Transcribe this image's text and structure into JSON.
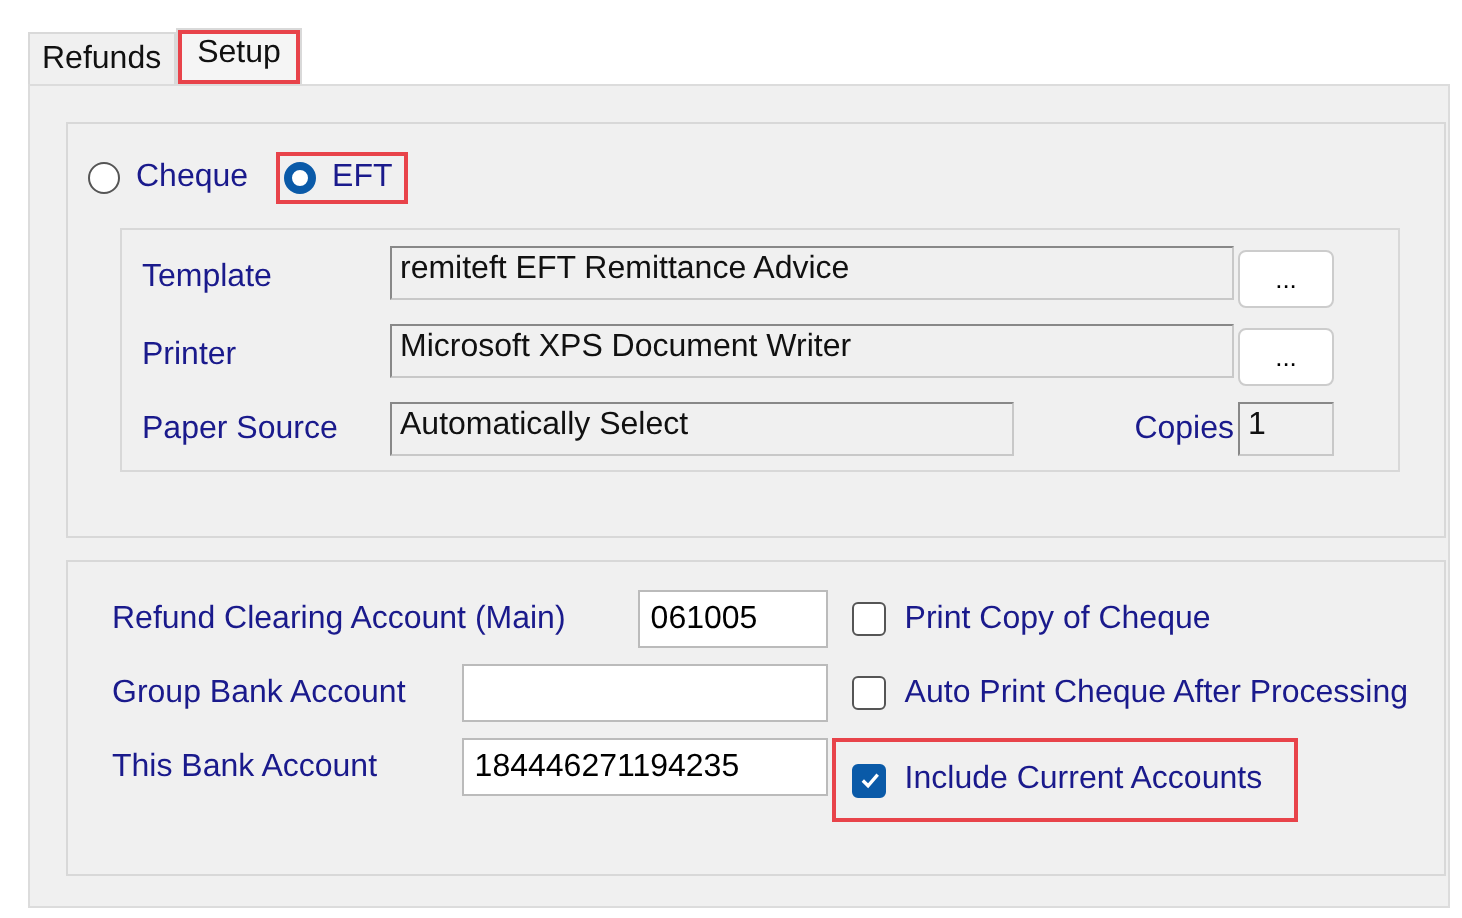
{
  "tabs": [
    {
      "label": "Refunds",
      "selected": false,
      "highlighted": false
    },
    {
      "label": "Setup",
      "selected": true,
      "highlighted": true
    }
  ],
  "output_type": [
    {
      "label": "Cheque",
      "selected": false,
      "highlighted": false
    },
    {
      "label": "EFT",
      "selected": true,
      "highlighted": true
    }
  ],
  "document": {
    "template": {
      "label": "Template",
      "value": "remiteft EFT Remittance Advice",
      "button": "..."
    },
    "printer": {
      "label": "Printer",
      "value": "Microsoft XPS Document Writer",
      "button": "..."
    },
    "paper_source": {
      "label": "Paper Source",
      "value": "Automatically Select"
    },
    "copies": {
      "label": "Copies",
      "value": "1"
    }
  },
  "accounts": [
    {
      "label": "Refund Clearing Account (Main)",
      "value": "061005"
    },
    {
      "label": "Group Bank Account"
    },
    {
      "label": "This Bank Account",
      "value": "184446271194235"
    }
  ],
  "options": [
    {
      "label": "Print Copy of Cheque",
      "checked": false,
      "highlighted": false
    },
    {
      "label": "Auto Print Cheque After Processing",
      "checked": false,
      "highlighted": false
    },
    {
      "label": "Include Current Accounts",
      "checked": true,
      "highlighted": true
    }
  ]
}
